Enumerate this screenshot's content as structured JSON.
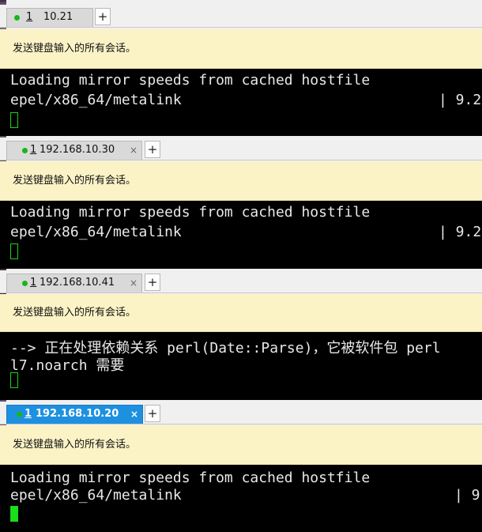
{
  "sessions": [
    {
      "index": "1",
      "host": "10.21",
      "active": false,
      "banner": "发送键盘输入的所有会话。",
      "lines": [
        "Loading mirror speeds from cached hostfile",
        "epel/x86_64/metalink"
      ],
      "right_text": "| 9.2"
    },
    {
      "index": "1",
      "host": "192.168.10.30",
      "active": false,
      "banner": "发送键盘输入的所有会话。",
      "lines": [
        "Loading mirror speeds from cached hostfile",
        "epel/x86_64/metalink"
      ],
      "right_text": "| 9.2"
    },
    {
      "index": "1",
      "host": "192.168.10.41",
      "active": false,
      "banner": "发送键盘输入的所有会话。",
      "lines": [
        "--> 正在处理依赖关系 perl(Date::Parse)，它被软件包 perl",
        "l7.noarch 需要"
      ],
      "right_text": ""
    },
    {
      "index": "1",
      "host": "192.168.10.20",
      "active": true,
      "banner": "发送键盘输入的所有会话。",
      "lines": [
        "Loading mirror speeds from cached hostfile",
        "epel/x86_64/metalink"
      ],
      "right_text": "| 9"
    }
  ],
  "labels": {
    "close": "×",
    "add": "+"
  },
  "colors": {
    "active_tab": "#1e90e0",
    "status_dot": "#17b617",
    "banner_bg": "#fbf3c6",
    "terminal_bg": "#000000",
    "cursor": "#19d219"
  }
}
